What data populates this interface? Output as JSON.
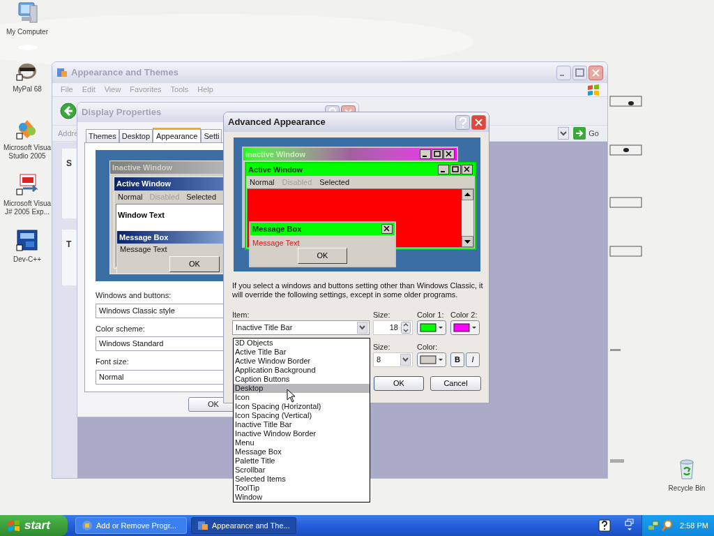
{
  "desktop_icons": [
    {
      "label": "My Computer",
      "kind": "computer"
    },
    {
      "label": "MyPal 68",
      "kind": "raccoon"
    },
    {
      "label": "Microsoft Visua Studio 2005",
      "kind": "studio"
    },
    {
      "label": "Microsoft Visua J# 2005 Exp...",
      "kind": "jsharp"
    },
    {
      "label": "Dev-C++",
      "kind": "dev"
    },
    {
      "label": "Recycle Bin",
      "kind": "bin"
    }
  ],
  "explorer": {
    "title": "Appearance and Themes",
    "menu": [
      "File",
      "Edit",
      "View",
      "Favorites",
      "Tools",
      "Help"
    ],
    "address_label": "Addre",
    "go": "Go",
    "panels": [
      {
        "heading": "S"
      },
      {
        "heading": "T"
      }
    ]
  },
  "display_properties": {
    "title": "Display Properties",
    "tabs": [
      {
        "label": "Themes",
        "selected": false
      },
      {
        "label": "Desktop",
        "selected": false
      },
      {
        "label": "Appearance",
        "selected": true
      },
      {
        "label": "Setti",
        "selected": false
      }
    ],
    "preview": {
      "inactive_title": "Inactive Window",
      "active_title": "Active Window",
      "menu": [
        {
          "label": "Normal",
          "disabled": false
        },
        {
          "label": "Disabled",
          "disabled": true
        },
        {
          "label": "Selected",
          "disabled": false
        }
      ],
      "window_text": "Window Text",
      "message_title": "Message Box",
      "message_text": "Message Text",
      "ok": "OK"
    },
    "fields": [
      {
        "label": "Windows and buttons:",
        "value": "Windows Classic style"
      },
      {
        "label": "Color scheme:",
        "value": "Windows Standard"
      },
      {
        "label": "Font size:",
        "value": "Normal"
      }
    ],
    "ok": "OK"
  },
  "advanced": {
    "title": "Advanced Appearance",
    "preview": {
      "inactive_title": "Inactive Window",
      "active_title": "Active Window",
      "menu": [
        {
          "label": "Normal",
          "disabled": false
        },
        {
          "label": "Disabled",
          "disabled": true
        },
        {
          "label": "Selected",
          "disabled": false
        }
      ],
      "message_title": "Message Box",
      "message_text": "Message Text",
      "ok": "OK"
    },
    "notice": "If you select a windows and buttons setting other than Windows Classic, it will override the following settings, except in some older programs.",
    "item_label": "Item:",
    "item_value": "Inactive Title Bar",
    "size_label": "Size:",
    "size_value": "18",
    "color1_label": "Color 1:",
    "color2_label": "Color 2:",
    "font_size_label": "Size:",
    "font_size_value": "8",
    "font_color_label": "Color:",
    "bold": "B",
    "italic": "I",
    "ok": "OK",
    "cancel": "Cancel"
  },
  "item_list": [
    {
      "label": "3D Objects",
      "selected": false
    },
    {
      "label": "Active Title Bar",
      "selected": false
    },
    {
      "label": "Active Window Border",
      "selected": false
    },
    {
      "label": "Application Background",
      "selected": false
    },
    {
      "label": "Caption Buttons",
      "selected": false
    },
    {
      "label": "Desktop",
      "selected": true
    },
    {
      "label": "Icon",
      "selected": false
    },
    {
      "label": "Icon Spacing (Horizontal)",
      "selected": false
    },
    {
      "label": "Icon Spacing (Vertical)",
      "selected": false
    },
    {
      "label": "Inactive Title Bar",
      "selected": false
    },
    {
      "label": "Inactive Window Border",
      "selected": false
    },
    {
      "label": "Menu",
      "selected": false
    },
    {
      "label": "Message Box",
      "selected": false
    },
    {
      "label": "Palette Title",
      "selected": false
    },
    {
      "label": "Scrollbar",
      "selected": false
    },
    {
      "label": "Selected Items",
      "selected": false
    },
    {
      "label": "ToolTip",
      "selected": false
    },
    {
      "label": "Window",
      "selected": false
    }
  ],
  "taskbar": {
    "start": "start",
    "tasks": [
      {
        "label": "Add or Remove Progr...",
        "selected": false
      },
      {
        "label": "Appearance and The...",
        "selected": true
      }
    ],
    "clock": "2:58 PM"
  }
}
